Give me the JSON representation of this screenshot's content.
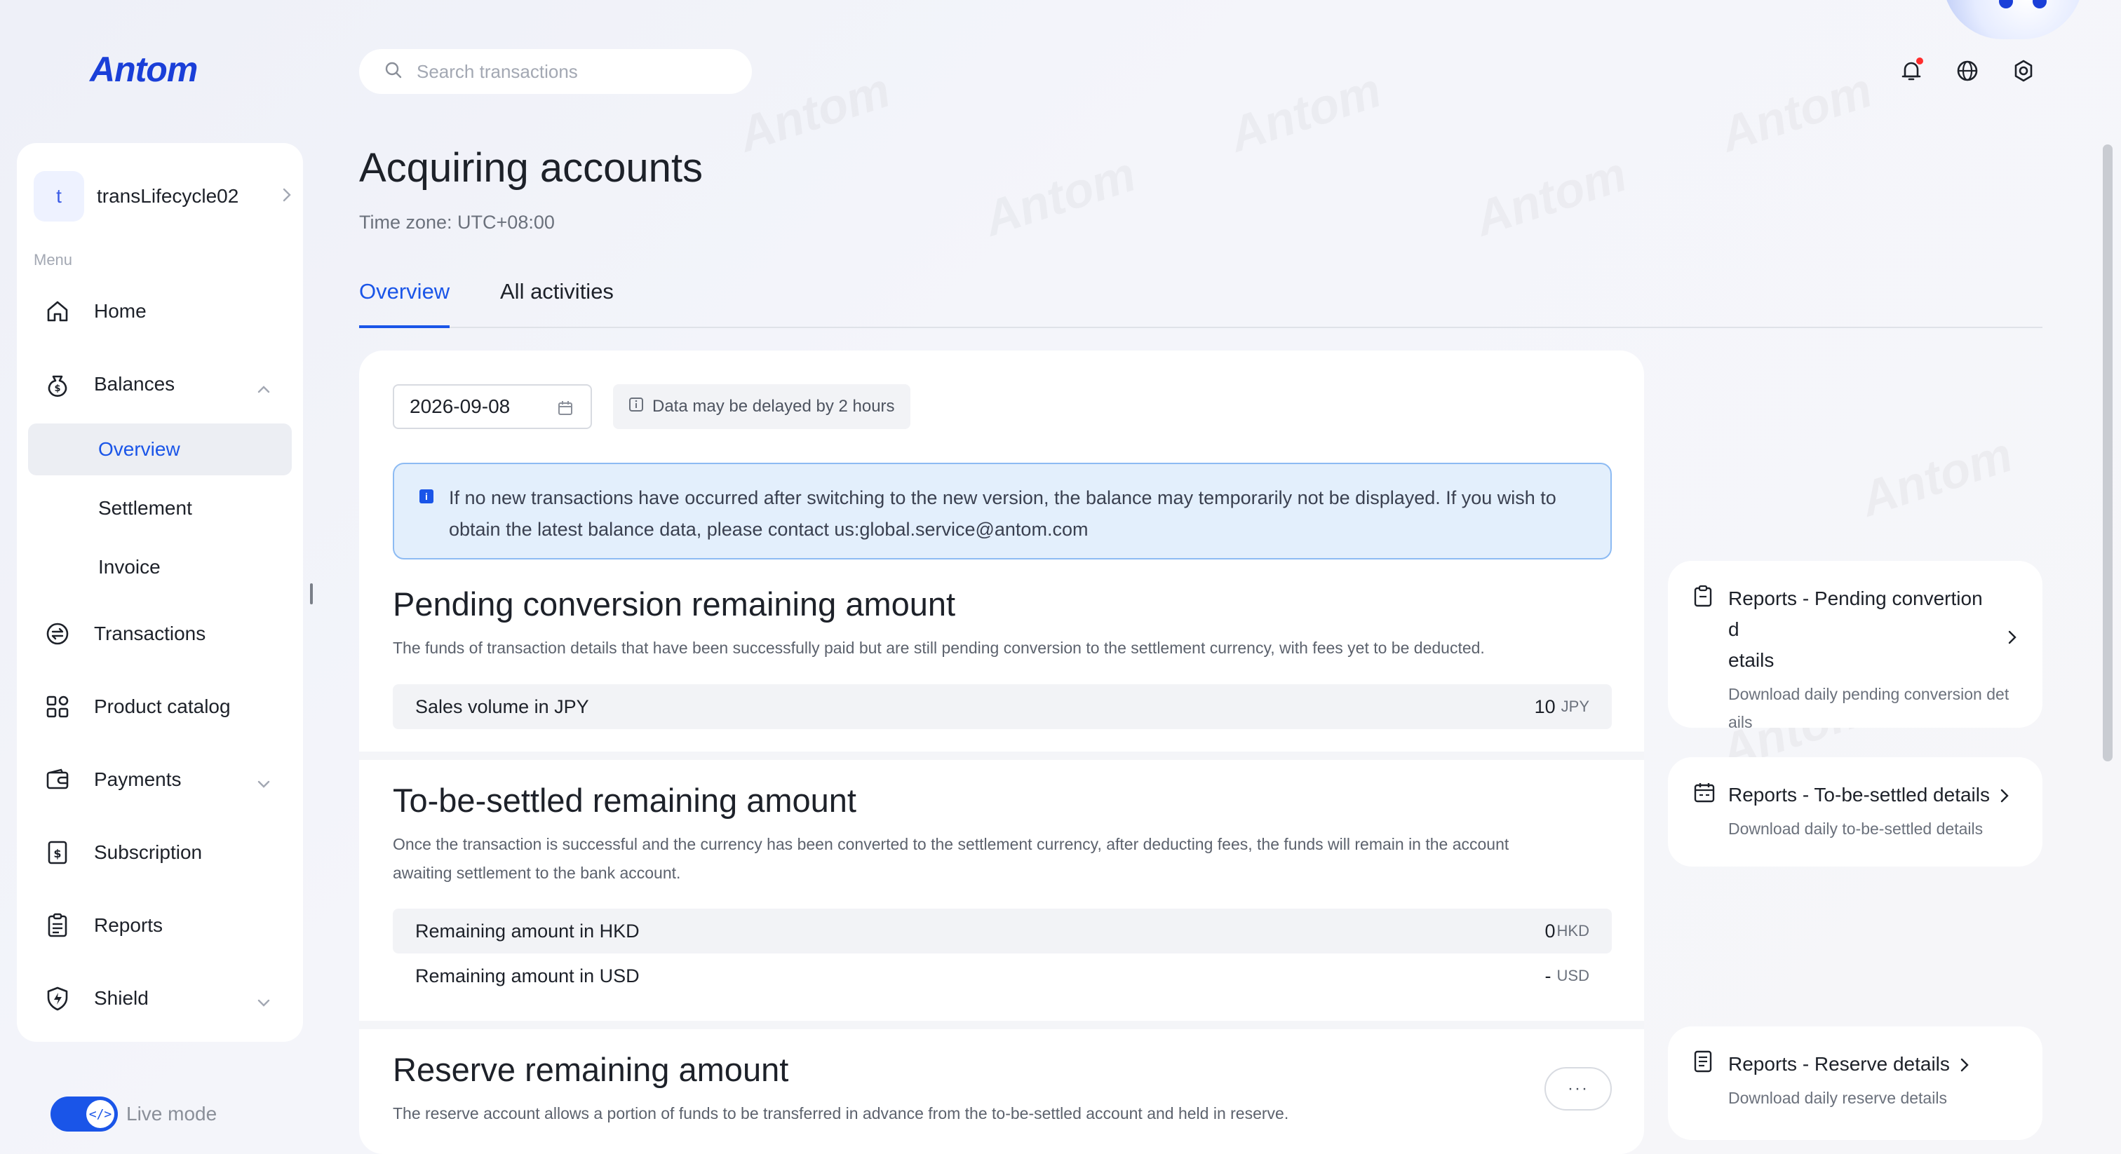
{
  "brand": {
    "logo": "Antom",
    "accent": "#1a55e8"
  },
  "search": {
    "placeholder": "Search transactions",
    "icon": "search-icon"
  },
  "topbar": {
    "icons": [
      "bell-icon",
      "globe-icon",
      "settings-icon"
    ]
  },
  "sidebar": {
    "account": {
      "initial": "t",
      "name": "transLifecycle02"
    },
    "menu_label": "Menu",
    "items": [
      {
        "label": "Home",
        "icon": "home-icon"
      },
      {
        "label": "Balances",
        "icon": "money-bag-icon",
        "expanded": true
      },
      {
        "label": "Transactions",
        "icon": "exchange-icon"
      },
      {
        "label": "Product catalog",
        "icon": "grid-icon"
      },
      {
        "label": "Payments",
        "icon": "wallet-icon",
        "expanded": false
      },
      {
        "label": "Subscription",
        "icon": "dollar-doc-icon"
      },
      {
        "label": "Reports",
        "icon": "clipboard-icon"
      },
      {
        "label": "Shield",
        "icon": "shield-icon",
        "expanded": false
      }
    ],
    "balances_sub": [
      {
        "label": "Overview",
        "active": true
      },
      {
        "label": "Settlement"
      },
      {
        "label": "Invoice"
      }
    ],
    "live_mode": {
      "label": "Live mode",
      "on": true
    }
  },
  "page": {
    "title": "Acquiring accounts",
    "timezone": "Time zone: UTC+08:00",
    "tabs": [
      {
        "label": "Overview",
        "active": true
      },
      {
        "label": "All activities"
      }
    ]
  },
  "overview": {
    "date": "2026-09-08",
    "delay_notice": "Data may be delayed by 2 hours",
    "info_line1": "If no new transactions have occurred after switching to the new version, the balance may temporarily not be displayed. If you wish to",
    "info_line2": "obtain the latest balance data, please contact us:global.service@antom.com",
    "pending": {
      "title": "Pending conversion remaining amount",
      "desc": "The funds of transaction details that have been successfully paid but are still pending conversion to the settlement currency, with fees yet to be deducted.",
      "rows": [
        {
          "label": "Sales volume in JPY",
          "amount": "10",
          "currency": "JPY"
        }
      ]
    },
    "to_be_settled": {
      "title": "To-be-settled remaining amount",
      "desc_line1": "Once the transaction is successful and the currency has been converted to the settlement currency, after deducting fees, the funds will remain in the account",
      "desc_line2": "awaiting settlement to the bank account.",
      "rows": [
        {
          "label": "Remaining amount in HKD",
          "amount": "0",
          "currency": "HKD"
        },
        {
          "label": "Remaining amount in USD",
          "amount": "-",
          "currency": "USD"
        }
      ]
    },
    "reserve": {
      "title": "Reserve remaining amount",
      "desc": "The reserve account allows a portion of funds to be transferred in advance from the to-be-settled account and held in reserve.",
      "more_label": "···"
    }
  },
  "reports": [
    {
      "title_line1": "Reports - Pending convertion d",
      "title_line2": "etails",
      "desc_line1": "Download daily pending conversion det",
      "desc_line2": "ails",
      "icon": "clipboard-icon"
    },
    {
      "title": "Reports - To-be-settled details",
      "desc": "Download daily to-be-settled details",
      "icon": "calendar-icon"
    },
    {
      "title": "Reports - Reserve details",
      "desc": "Download daily reserve details",
      "icon": "document-icon"
    }
  ]
}
